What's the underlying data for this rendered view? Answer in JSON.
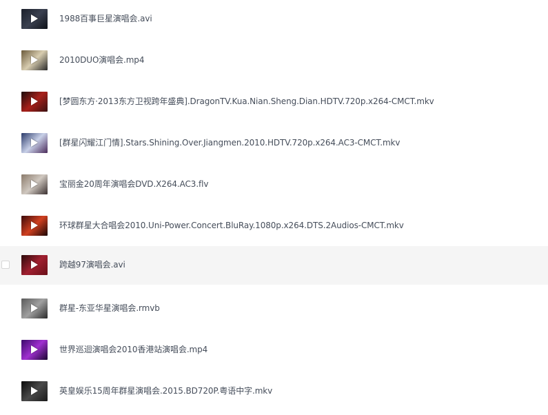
{
  "files": [
    {
      "name": "1988百事巨星演唱会.avi",
      "thumb_colors": [
        "#1a1f2a",
        "#3a4050",
        "#0e1118"
      ],
      "hovered": false
    },
    {
      "name": "2010DUO演唱会.mp4",
      "thumb_colors": [
        "#6b5a3a",
        "#d8cdb0",
        "#2a2a2a"
      ],
      "hovered": false
    },
    {
      "name": "[梦圆东方·2013东方卫视跨年盛典].DragonTV.Kua.Nian.Sheng.Dian.HDTV.720p.x264-CMCT.mkv",
      "thumb_colors": [
        "#1a0c0c",
        "#a8201a",
        "#3a1010"
      ],
      "hovered": false
    },
    {
      "name": "[群星闪耀江门情].Stars.Shining.Over.Jiangmen.2010.HDTV.720p.x264.AC3-CMCT.mkv",
      "thumb_colors": [
        "#2a3a6a",
        "#c8d0e8",
        "#4a2a5a"
      ],
      "hovered": false
    },
    {
      "name": "宝丽金20周年演唱会DVD.X264.AC3.flv",
      "thumb_colors": [
        "#8a7a6a",
        "#d0c8c0",
        "#3a3030"
      ],
      "hovered": false
    },
    {
      "name": "环球群星大合唱会2010.Uni-Power.Concert.BluRay.1080p.x264.DTS.2Audios-CMCT.mkv",
      "thumb_colors": [
        "#3a0a0a",
        "#d04020",
        "#1a0505"
      ],
      "hovered": false
    },
    {
      "name": "跨越97演唱会.avi",
      "thumb_colors": [
        "#2a0a0a",
        "#a02030",
        "#6a1018"
      ],
      "hovered": true
    },
    {
      "name": "群星-东亚华星演唱会.rmvb",
      "thumb_colors": [
        "#5a5a5a",
        "#a0a0a0",
        "#2a2a2a"
      ],
      "hovered": false
    },
    {
      "name": "世界巡迴演唱会2010香港站演唱会.mp4",
      "thumb_colors": [
        "#3a0a6a",
        "#a030d0",
        "#1a0530"
      ],
      "hovered": false
    },
    {
      "name": "英皇娱乐15周年群星演唱会.2015.BD720P.粤语中字.mkv",
      "thumb_colors": [
        "#0a0a0a",
        "#4a4a4a",
        "#1a1a1a"
      ],
      "hovered": false
    }
  ]
}
